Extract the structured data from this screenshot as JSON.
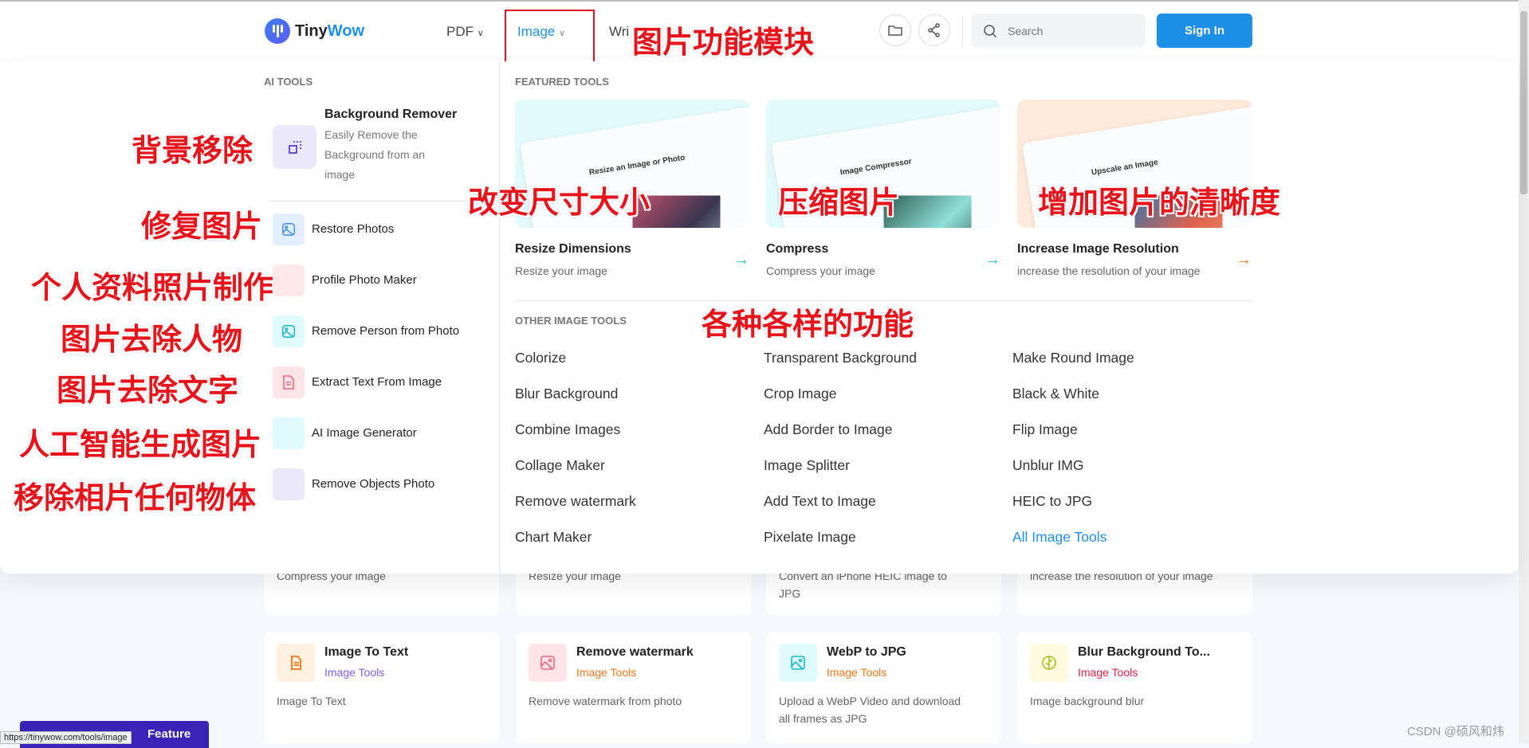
{
  "header": {
    "brand_a": "Tiny",
    "brand_b": "Wow",
    "nav": [
      {
        "label": "PDF"
      },
      {
        "label": "Image"
      },
      {
        "label": "Wri"
      }
    ],
    "search_placeholder": "Search",
    "sign_in": "Sign In",
    "accent": "#1e8fe6"
  },
  "annotations": {
    "nav": "图片功能模块",
    "bg_remover": "背景移除",
    "restore": "修复图片",
    "profile": "个人资料照片制作",
    "remove_person": "图片去除人物",
    "extract_text": "图片去除文字",
    "ai_gen": "人工智能生成图片",
    "remove_objects": "移除相片任何物体",
    "resize": "改变尺寸大小",
    "compress": "压缩图片",
    "upscale": "增加图片的清晰度",
    "other": "各种各样的功能"
  },
  "ai_tools": {
    "heading": "AI TOOLS",
    "featured": {
      "title": "Background Remover",
      "desc1": "Easily Remove the",
      "desc2": "Background from an",
      "desc3": "image"
    },
    "items": [
      {
        "label": "Restore Photos",
        "icon": "image-icon"
      },
      {
        "label": "Profile Photo Maker",
        "icon": "user-icon"
      },
      {
        "label": "Remove Person from Photo",
        "icon": "image-icon"
      },
      {
        "label": "Extract Text From Image",
        "icon": "document-icon"
      },
      {
        "label": "AI Image Generator",
        "icon": "sparkle-icon"
      },
      {
        "label": "Remove Objects Photo",
        "icon": "eraser-icon"
      }
    ]
  },
  "featured": {
    "heading": "FEATURED TOOLS",
    "items": [
      {
        "title": "Resize Dimensions",
        "desc": "Resize your image",
        "mock": "Resize an Image or Photo",
        "arrow_color": "#22c3d6"
      },
      {
        "title": "Compress",
        "desc": "Compress your image",
        "mock": "Image Compressor",
        "arrow_color": "#22c3d6"
      },
      {
        "title": "Increase Image Resolution",
        "desc": "increase the resolution of your image",
        "mock": "Upscale an Image",
        "arrow_color": "#f97316"
      }
    ]
  },
  "other": {
    "heading": "OTHER IMAGE TOOLS",
    "columns": [
      [
        "Colorize",
        "Blur Background",
        "Combine Images",
        "Collage Maker",
        "Remove watermark",
        "Chart Maker"
      ],
      [
        "Transparent Background",
        "Crop Image",
        "Add Border to Image",
        "Image Splitter",
        "Add Text to Image",
        "Pixelate Image"
      ],
      [
        "Make Round Image",
        "Black & White",
        "Flip Image",
        "Unblur IMG",
        "HEIC to JPG",
        "All Image Tools"
      ]
    ]
  },
  "bg_row1": [
    "Compress your image",
    "Resize your image",
    "Convert an iPhone HEIC image to JPG",
    "increase the resolution of your image"
  ],
  "bg_row2": [
    {
      "title": "Image To Text",
      "category": "Image Tools",
      "desc": "Image To Text",
      "cat_color": "#7c5cf5"
    },
    {
      "title": "Remove watermark",
      "category": "Image Tools",
      "desc": "Remove watermark from photo",
      "cat_color": "#f97316"
    },
    {
      "title": "WebP to JPG",
      "category": "Image Tools",
      "desc": "Upload a WebP Video and download all frames as JPG",
      "cat_color": "#f97316"
    },
    {
      "title": "Blur Background To...",
      "category": "Image Tools",
      "desc": "Image background blur",
      "cat_color": "#e11d48"
    }
  ],
  "feature_button": "Feature",
  "status_url": "https://tinywow.com/tools/image",
  "watermark": "CSDN @硕风和炜"
}
